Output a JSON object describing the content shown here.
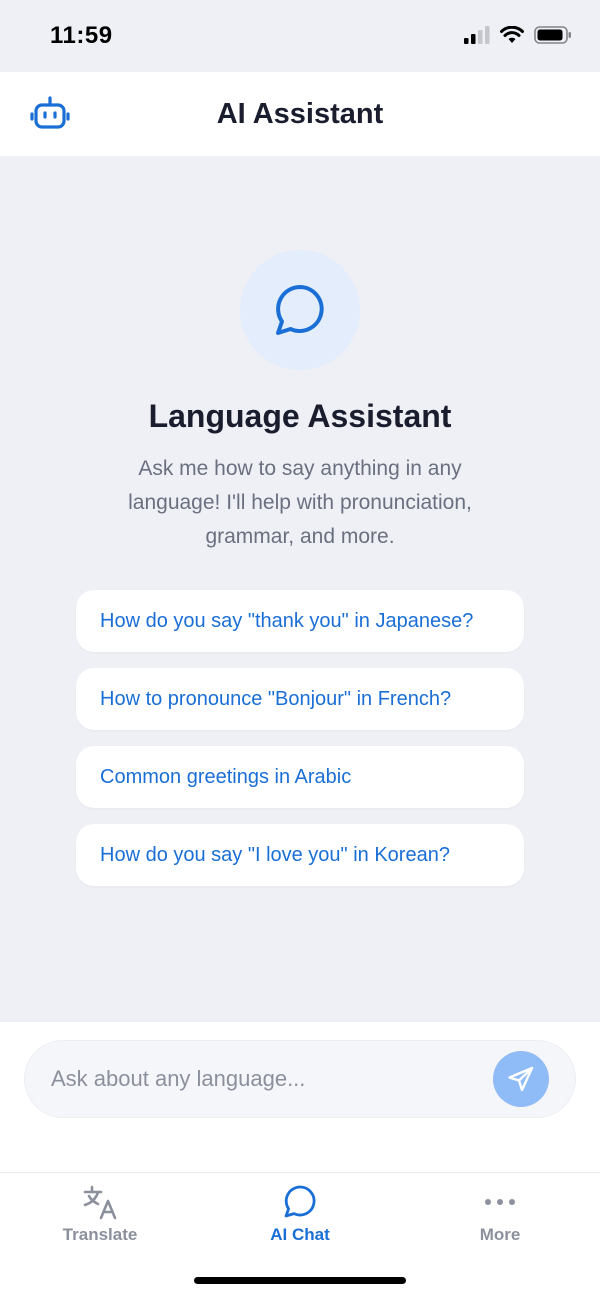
{
  "status": {
    "time": "11:59"
  },
  "header": {
    "title": "AI Assistant",
    "icon": "robot-icon"
  },
  "hero": {
    "icon": "chat-bubble-icon",
    "title": "Language Assistant",
    "subtitle": "Ask me how to say anything in any language! I'll help with pronunciation, grammar, and more."
  },
  "suggestions": [
    "How do you say \"thank you\" in Japanese?",
    "How to pronounce \"Bonjour\" in French?",
    "Common greetings in Arabic",
    "How do you say \"I love you\" in Korean?"
  ],
  "composer": {
    "placeholder": "Ask about any language...",
    "send_icon": "send-icon"
  },
  "tabs": [
    {
      "label": "Translate",
      "icon": "translate-icon",
      "active": false
    },
    {
      "label": "AI Chat",
      "icon": "chat-bubble-icon",
      "active": true
    },
    {
      "label": "More",
      "icon": "more-dots-icon",
      "active": false
    }
  ],
  "colors": {
    "accent": "#1a6fd6",
    "background": "#eef0f5",
    "send_button": "#8fbbf6"
  }
}
